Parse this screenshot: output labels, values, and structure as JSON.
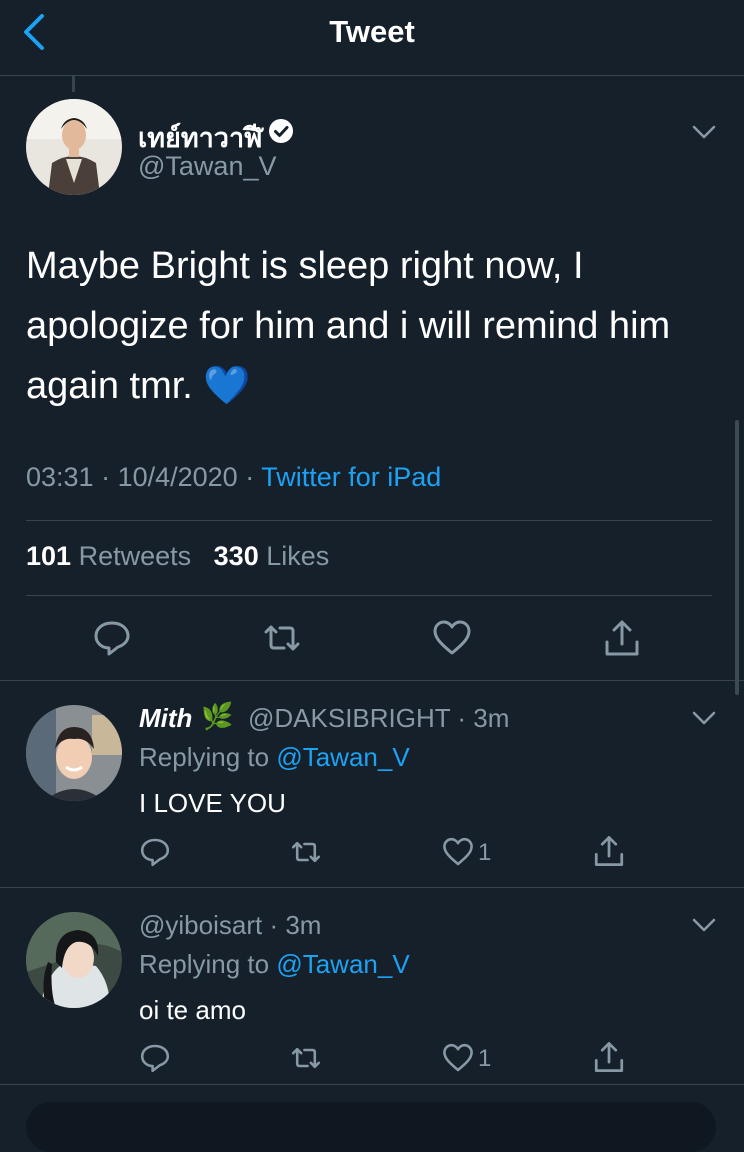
{
  "header": {
    "title": "Tweet"
  },
  "tweet": {
    "display_name": "เทย์ทาวาฬี",
    "handle": "@Tawan_V",
    "text": "Maybe Bright is sleep right now, I apologize for him and i will remind him again tmr. 💙",
    "time": "03:31",
    "date": "10/4/2020",
    "source": "Twitter for iPad",
    "retweets": "101",
    "retweets_label": "Retweets",
    "likes": "330",
    "likes_label": "Likes"
  },
  "replies": [
    {
      "display_name": "Mith",
      "name_emoji": "🌿",
      "handle": "@DAKSIBRIGHT",
      "time": "· 3m",
      "replying_label": "Replying to",
      "replying_to": "@Tawan_V",
      "text": "I LOVE YOU",
      "like_count": "1"
    },
    {
      "handle": "@yiboisart",
      "time": "· 3m",
      "replying_label": "Replying to",
      "replying_to": "@Tawan_V",
      "text": "oi te amo",
      "like_count": "1"
    }
  ],
  "colors": {
    "background": "#15202b",
    "accent": "#1da1f2",
    "secondary_text": "#8899a6",
    "divider": "#38444d"
  },
  "icons": [
    "back-icon",
    "verified-icon",
    "chevron-down-icon",
    "reply-icon",
    "retweet-icon",
    "like-icon",
    "share-icon"
  ]
}
